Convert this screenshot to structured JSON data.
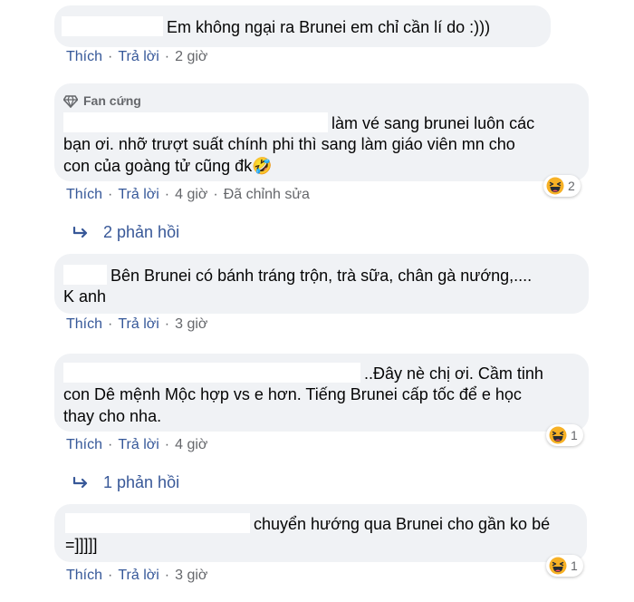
{
  "comments": [
    {
      "text": "Em không ngại ra Brunei em chỉ cần lí do :)))",
      "like": "Thích",
      "reply": "Trả lời",
      "time": "2 giờ"
    },
    {
      "badge": "Fan cứng",
      "text_line1": "làm vé sang brunei luôn các",
      "text_line2": "bạn ơi. nhỡ trượt suất chính phi thì sang làm giáo viên mn cho",
      "text_line3": "con của goàng tử cũng đk🤣",
      "like": "Thích",
      "reply": "Trả lời",
      "time": "4 giờ",
      "edited": "Đã chỉnh sửa",
      "reaction_count": "2",
      "replies_label": "2 phản hồi"
    },
    {
      "text_line1": "Bên Brunei có bánh tráng trộn, trà sữa, chân gà nướng,....",
      "text_line2": "K anh",
      "like": "Thích",
      "reply": "Trả lời",
      "time": "3 giờ"
    },
    {
      "text_line1": "..Đây nè chị ơi. Cầm tinh",
      "text_line2": "con Dê mệnh Mộc hợp vs e hơn. Tiếng Brunei cấp tốc để e học",
      "text_line3": "thay cho nha.",
      "like": "Thích",
      "reply": "Trả lời",
      "time": "4 giờ",
      "reaction_count": "1",
      "replies_label": "1 phản hồi"
    },
    {
      "text_line1": "chuyển hướng qua Brunei cho gần ko bé",
      "text_line2": "=]]]]]",
      "like": "Thích",
      "reply": "Trả lời",
      "time": "3 giờ",
      "reaction_count": "1"
    }
  ],
  "colors": {
    "bubble": "#f0f2f5",
    "action_link": "#365899",
    "meta_text": "#65676b",
    "replies_link": "#385898"
  },
  "icons": [
    "gem-icon",
    "haha-icon",
    "reply-arrow-icon"
  ]
}
